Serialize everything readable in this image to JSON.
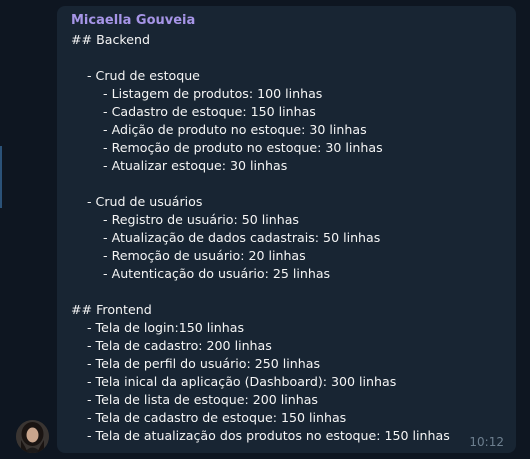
{
  "message": {
    "sender": "Micaella Gouveia",
    "time": "10:12",
    "lines": [
      "## Backend",
      "",
      "    - Crud de estoque",
      "        - Listagem de produtos: 100 linhas",
      "        - Cadastro de estoque: 150 linhas",
      "        - Adição de produto no estoque: 30 linhas",
      "        - Remoção de produto no estoque: 30 linhas",
      "        - Atualizar estoque: 30 linhas",
      "",
      "    - Crud de usuários",
      "        - Registro de usuário: 50 linhas",
      "        - Atualização de dados cadastrais: 50 linhas",
      "        - Remoção de usuário: 20 linhas",
      "        - Autenticação do usuário: 25 linhas",
      "",
      "## Frontend",
      "    - Tela de login:150 linhas",
      "    - Tela de cadastro: 200 linhas",
      "    - Tela de perfil do usuário: 250 linhas",
      "    - Tela inical da aplicação (Dashboard): 300 linhas",
      "    - Tela de lista de estoque: 200 linhas",
      "    - Tela de cadastro de estoque: 150 linhas",
      "    - Tela de atualização dos produtos no estoque: 150 linhas"
    ]
  }
}
